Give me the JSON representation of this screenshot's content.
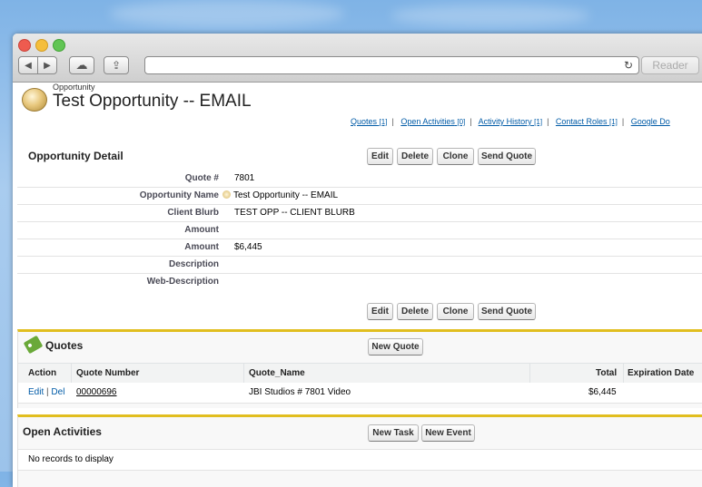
{
  "browser": {
    "reader_label": "Reader",
    "reload_glyph": "↻",
    "back_glyph": "◀",
    "forward_glyph": "▶",
    "cloud_icon": "☁",
    "share_icon": "⇪"
  },
  "record": {
    "object_type": "Opportunity",
    "title": "Test Opportunity -- EMAIL"
  },
  "related_links": [
    {
      "label": "Quotes",
      "count": "[1]"
    },
    {
      "label": "Open Activities",
      "count": "[0]"
    },
    {
      "label": "Activity History",
      "count": "[1]"
    },
    {
      "label": "Contact Roles",
      "count": "[1]"
    },
    {
      "label": "Google Do",
      "count": ""
    }
  ],
  "detail": {
    "heading": "Opportunity Detail",
    "buttons": {
      "edit": "Edit",
      "delete": "Delete",
      "clone": "Clone",
      "send_quote": "Send Quote"
    },
    "fields": [
      {
        "label": "Quote #",
        "value": "7801"
      },
      {
        "label": "Opportunity Name",
        "value": "Test Opportunity -- EMAIL"
      },
      {
        "label": "Client Blurb",
        "value": "TEST OPP -- CLIENT BLURB"
      },
      {
        "label": "Amount",
        "value": ""
      },
      {
        "label": "Amount",
        "value": "$6,445"
      },
      {
        "label": "Description",
        "value": ""
      },
      {
        "label": "Web-Description",
        "value": ""
      }
    ]
  },
  "quotes": {
    "heading": "Quotes",
    "new_button": "New Quote",
    "columns": {
      "action": "Action",
      "number": "Quote Number",
      "name": "Quote_Name",
      "total": "Total",
      "expiration": "Expiration Date"
    },
    "rows": [
      {
        "edit": "Edit",
        "sep": "|",
        "del": "Del",
        "number": "00000696",
        "name": "JBI Studios # 7801 Video",
        "total": "$6,445",
        "expiration": ""
      }
    ]
  },
  "activities": {
    "heading": "Open Activities",
    "new_task": "New Task",
    "new_event": "New Event",
    "empty": "No records to display"
  },
  "colors": {
    "accent": "#e1be1f",
    "link": "#015ba7"
  }
}
